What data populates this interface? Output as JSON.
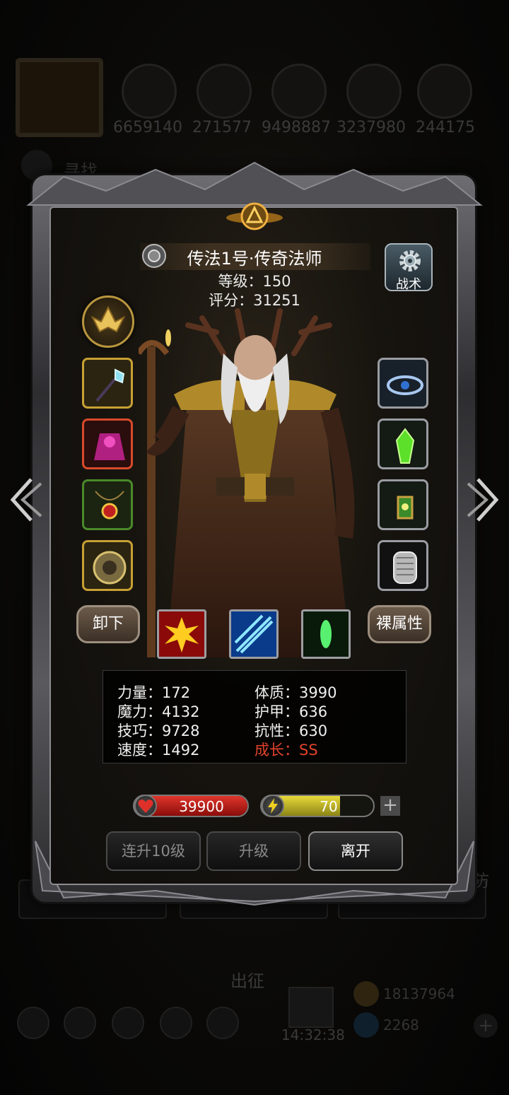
{
  "background": {
    "resources": [
      "6659140",
      "271577",
      "9498887",
      "3237980",
      "244175"
    ],
    "seek_text": "寻找",
    "sortie_text": "出征",
    "clock": "14:32:38",
    "gold": "18137964",
    "gems": "2268",
    "side_text": "防"
  },
  "character": {
    "name": "传法1号·传奇法师",
    "level": "等级：150",
    "score": "评分：31251"
  },
  "tactics_label": "战术",
  "unequip_label": "卸下",
  "base_attr_label": "裸属性",
  "stats": {
    "strength": "力量：172",
    "magic": "魔力：4132",
    "skill": "技巧：9728",
    "speed": "速度：1492",
    "constitution": "体质：3990",
    "armor": "护甲：636",
    "resistance": "抗性：630",
    "growth": "成长：SS"
  },
  "hp": {
    "value": "39900",
    "fill": 1.0,
    "color": "#d02a22"
  },
  "energy": {
    "value": "70",
    "fill": 0.7,
    "color": "#d8c82e"
  },
  "actions": {
    "level10": "连升10级",
    "levelup": "升级",
    "leave": "离开"
  },
  "equipment_left": [
    "staff-icon",
    "robe-icon",
    "amulet-icon",
    "medallion-icon"
  ],
  "equipment_right": [
    "circlet-icon",
    "green-crystal-icon",
    "lantern-icon",
    "chainmail-icon"
  ],
  "skills": [
    "fire-burst-icon",
    "ice-slash-icon",
    "green-spirit-icon"
  ]
}
